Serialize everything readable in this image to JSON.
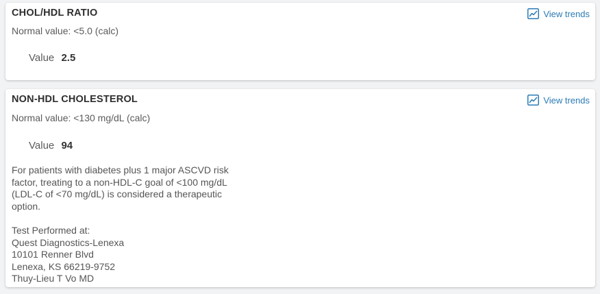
{
  "results": [
    {
      "title": "CHOL/HDL RATIO",
      "normal_value": "Normal value: <5.0 (calc)",
      "value_label": "Value",
      "value": "2.5",
      "trends_label": "View trends",
      "trends_icon": "trend-chart-icon"
    },
    {
      "title": "NON-HDL CHOLESTEROL",
      "normal_value": "Normal value: <130 mg/dL (calc)",
      "value_label": "Value",
      "value": "94",
      "trends_label": "View trends",
      "trends_icon": "trend-chart-icon",
      "comment": "For patients with diabetes plus 1 major ASCVD risk factor, treating to a non-HDL-C goal of <100 mg/dL (LDL-C of <70 mg/dL) is considered a therapeutic option.",
      "performed_at": {
        "heading": "Test Performed at:",
        "lab_name": "Quest Diagnostics-Lenexa",
        "address_line1": "10101 Renner Blvd",
        "address_line2": "Lenexa, KS 66219-9752",
        "director": "Thuy-Lieu T Vo MD"
      }
    }
  ],
  "colors": {
    "link": "#2b7bb4",
    "background": "#f2f3f4",
    "card": "#ffffff"
  }
}
